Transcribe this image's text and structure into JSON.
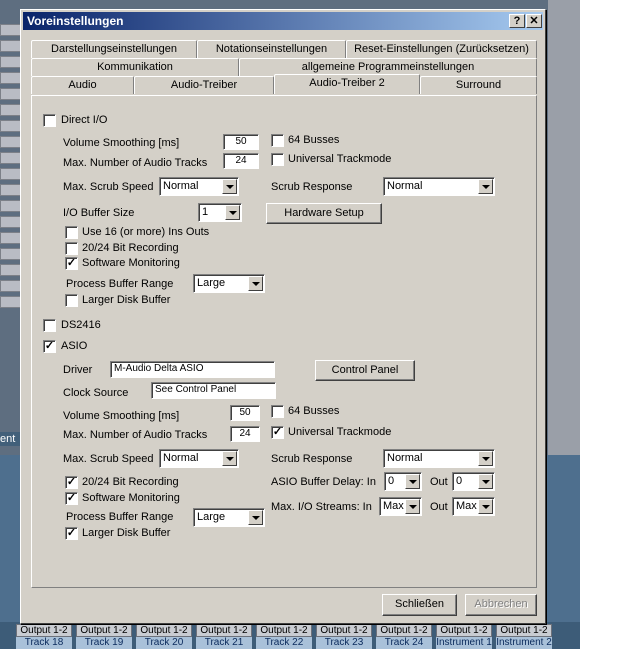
{
  "dialog": {
    "title": "Voreinstellungen",
    "help_label": "?",
    "close_label": "✕"
  },
  "tabs_row1": [
    {
      "label": "Darstellungseinstellungen"
    },
    {
      "label": "Notationseinstellungen"
    },
    {
      "label": "Reset-Einstellungen (Zurücksetzen)"
    }
  ],
  "tabs_row2": [
    {
      "label": "Kommunikation"
    },
    {
      "label": "allgemeine Programmeinstellungen"
    }
  ],
  "tabs_row3": [
    {
      "label": "Audio"
    },
    {
      "label": "Audio-Treiber"
    },
    {
      "label": "Audio-Treiber 2"
    },
    {
      "label": "Surround"
    }
  ],
  "direct_io": {
    "label": "Direct I/O",
    "checked": false,
    "volume_smoothing_label": "Volume Smoothing [ms]",
    "volume_smoothing_value": "50",
    "max_tracks_label": "Max. Number of Audio Tracks",
    "max_tracks_value": "24",
    "busses_label": "64 Busses",
    "busses_checked": false,
    "trackmode_label": "Universal Trackmode",
    "trackmode_checked": false,
    "scrub_speed_label": "Max. Scrub Speed",
    "scrub_speed_value": "Normal",
    "scrub_response_label": "Scrub Response",
    "scrub_response_value": "Normal",
    "buffer_size_label": "I/O Buffer Size",
    "buffer_size_value": "1",
    "hardware_setup_label": "Hardware Setup",
    "use16_label": "Use 16 (or more) Ins  Outs",
    "use16_checked": false,
    "bit_recording_label": "20/24 Bit Recording",
    "bit_recording_checked": false,
    "monitoring_label": "Software Monitoring",
    "monitoring_checked": true,
    "buffer_range_label": "Process Buffer Range",
    "buffer_range_value": "Large",
    "disk_buffer_label": "Larger Disk Buffer",
    "disk_buffer_checked": false
  },
  "ds2416": {
    "label": "DS2416",
    "checked": false
  },
  "asio": {
    "label": "ASIO",
    "checked": true,
    "driver_label": "Driver",
    "driver_value": "M-Audio Delta ASIO",
    "clock_label": "Clock Source",
    "clock_value": "See Control Panel",
    "control_panel_label": "Control Panel",
    "volume_smoothing_label": "Volume Smoothing [ms]",
    "volume_smoothing_value": "50",
    "max_tracks_label": "Max. Number of Audio Tracks",
    "max_tracks_value": "24",
    "busses_label": "64 Busses",
    "busses_checked": false,
    "trackmode_label": "Universal Trackmode",
    "trackmode_checked": true,
    "scrub_speed_label": "Max. Scrub Speed",
    "scrub_speed_value": "Normal",
    "scrub_response_label": "Scrub Response",
    "scrub_response_value": "Normal",
    "bit_recording_label": "20/24 Bit Recording",
    "bit_recording_checked": true,
    "monitoring_label": "Software Monitoring",
    "monitoring_checked": true,
    "buffer_delay_label": "ASIO Buffer Delay:  In",
    "buffer_delay_in": "0",
    "out_label": "Out",
    "buffer_delay_out": "0",
    "streams_label": "Max. I/O Streams:  In",
    "streams_in": "Max",
    "streams_out": "Max",
    "buffer_range_label": "Process Buffer Range",
    "buffer_range_value": "Large",
    "disk_buffer_label": "Larger Disk Buffer",
    "disk_buffer_checked": true
  },
  "footer": {
    "close_label": "Schließen",
    "cancel_label": "Abbrechen"
  },
  "background": {
    "left_label": "ent",
    "tracks": [
      {
        "out": "Output 1-2",
        "name": "Track 18"
      },
      {
        "out": "Output 1-2",
        "name": "Track 19"
      },
      {
        "out": "Output 1-2",
        "name": "Track 20"
      },
      {
        "out": "Output 1-2",
        "name": "Track 21"
      },
      {
        "out": "Output 1-2",
        "name": "Track 22"
      },
      {
        "out": "Output 1-2",
        "name": "Track 23"
      },
      {
        "out": "Output 1-2",
        "name": "Track 24"
      },
      {
        "out": "Output 1-2",
        "name": "Instrument 1"
      },
      {
        "out": "Output 1-2",
        "name": "Instrument 2"
      }
    ]
  },
  "colors": {
    "titlebar_start": "#0a246a",
    "titlebar_end": "#a6caf0",
    "dialog_bg": "#d4d0c8"
  }
}
